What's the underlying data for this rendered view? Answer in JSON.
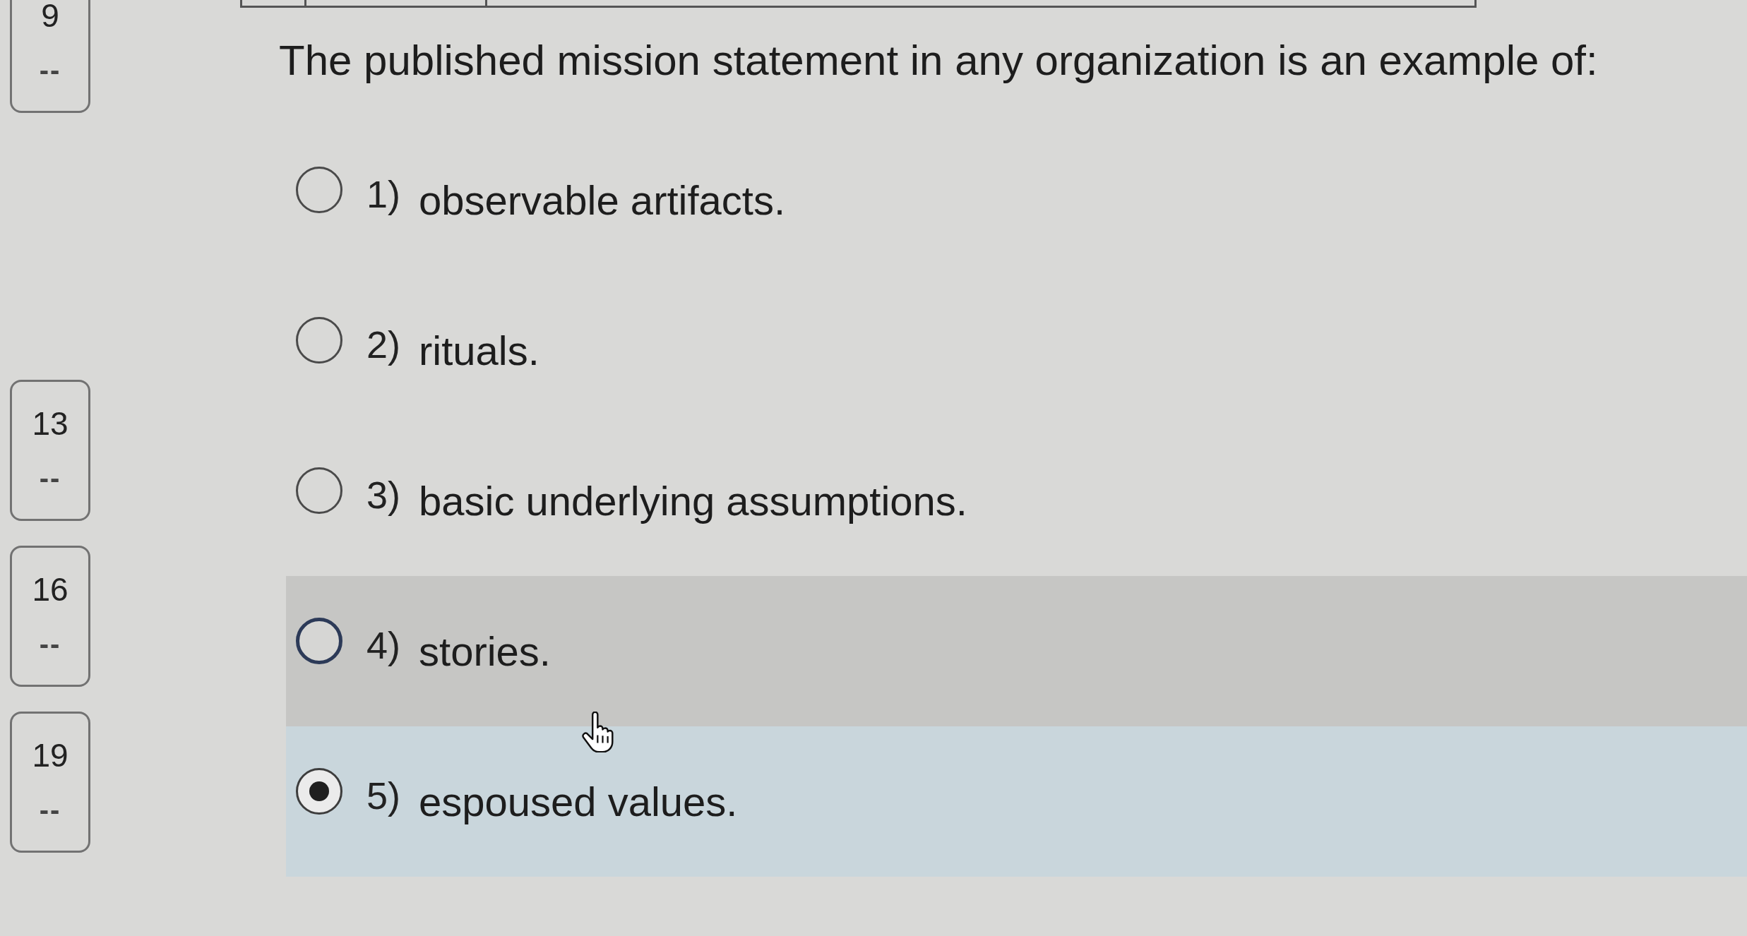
{
  "question_nav": [
    {
      "number": "9",
      "status": "--"
    },
    {
      "number": "13",
      "status": "--"
    },
    {
      "number": "16",
      "status": "--"
    },
    {
      "number": "19",
      "status": "--"
    }
  ],
  "question": {
    "text": "The published mission statement in any organization is an example of:"
  },
  "options": [
    {
      "number": "1)",
      "text": "observable artifacts.",
      "selected": false,
      "hovered": false
    },
    {
      "number": "2)",
      "text": "rituals.",
      "selected": false,
      "hovered": false
    },
    {
      "number": "3)",
      "text": "basic underlying assumptions.",
      "selected": false,
      "hovered": false
    },
    {
      "number": "4)",
      "text": "stories.",
      "selected": false,
      "hovered": true
    },
    {
      "number": "5)",
      "text": "espoused values.",
      "selected": true,
      "hovered": false
    }
  ]
}
